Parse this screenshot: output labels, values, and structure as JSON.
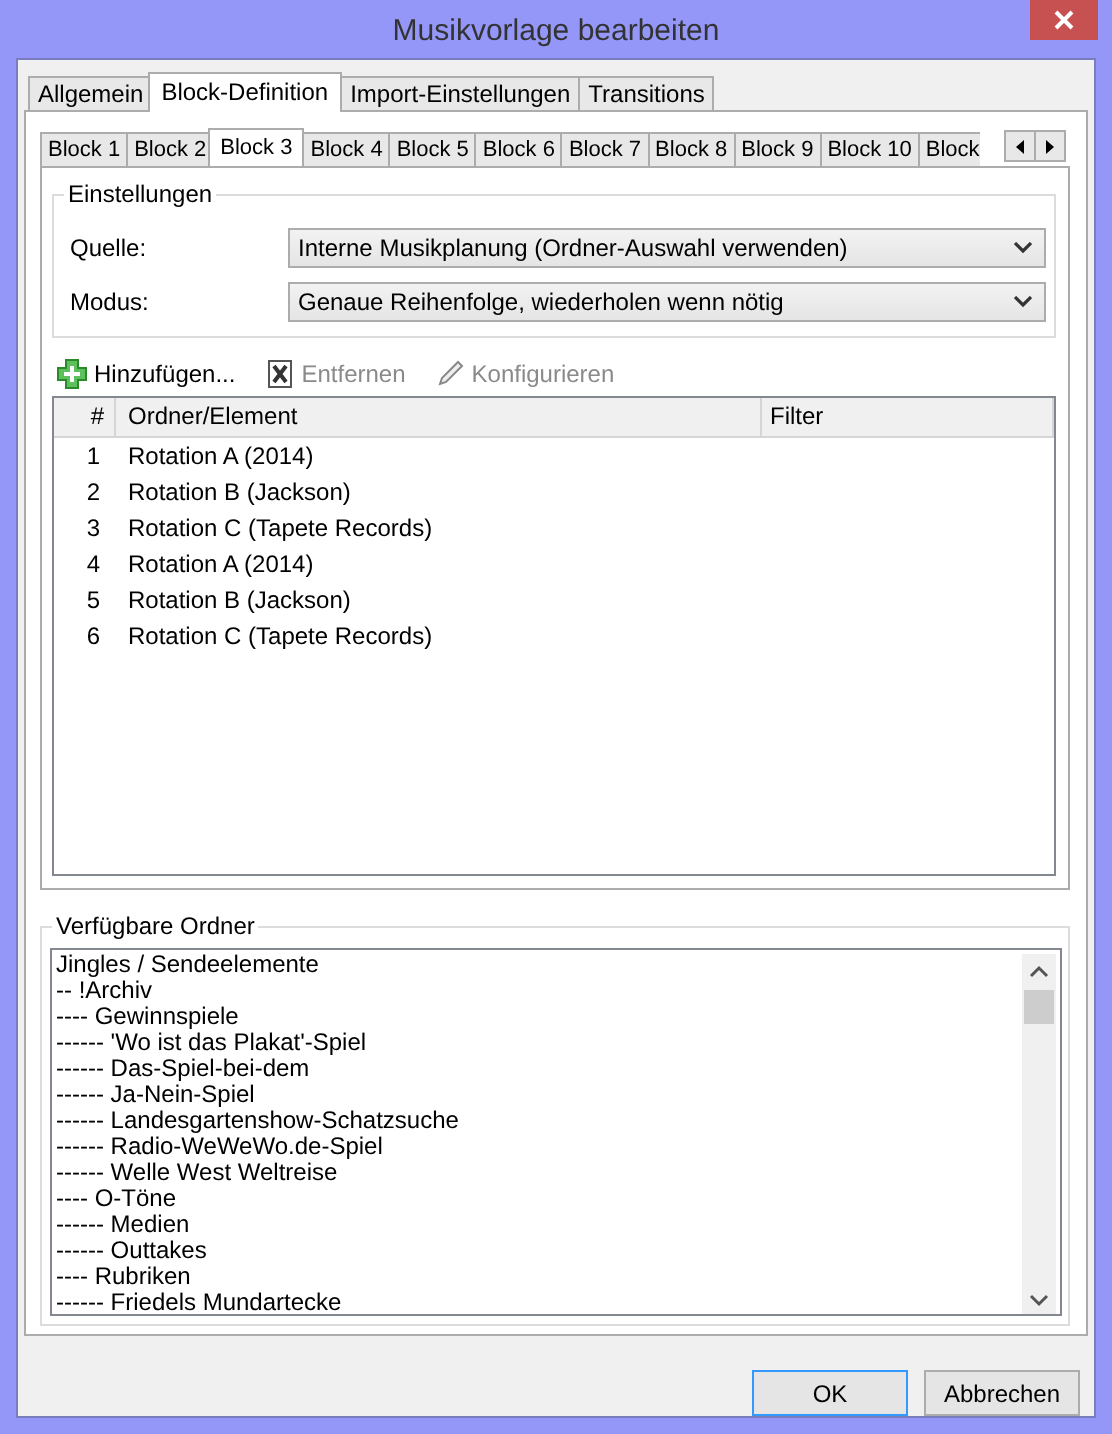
{
  "window": {
    "title": "Musikvorlage bearbeiten"
  },
  "tabs": [
    {
      "label": "Allgemein",
      "selected": false
    },
    {
      "label": "Block-Definition",
      "selected": true
    },
    {
      "label": "Import-Einstellungen",
      "selected": false
    },
    {
      "label": "Transitions",
      "selected": false
    }
  ],
  "block_tabs": [
    {
      "label": "Block 1",
      "selected": false
    },
    {
      "label": "Block 2",
      "selected": false
    },
    {
      "label": "Block 3",
      "selected": true
    },
    {
      "label": "Block 4",
      "selected": false
    },
    {
      "label": "Block 5",
      "selected": false
    },
    {
      "label": "Block 6",
      "selected": false
    },
    {
      "label": "Block 7",
      "selected": false
    },
    {
      "label": "Block 8",
      "selected": false
    },
    {
      "label": "Block 9",
      "selected": false
    },
    {
      "label": "Block 10",
      "selected": false
    },
    {
      "label": "Block",
      "selected": false
    }
  ],
  "settings": {
    "title": "Einstellungen",
    "fields": [
      {
        "label": "Quelle:",
        "value": "Interne Musikplanung (Ordner-Auswahl verwenden)"
      },
      {
        "label": "Modus:",
        "value": "Genaue Reihenfolge, wiederholen wenn nötig"
      }
    ]
  },
  "toolbar": [
    {
      "kind": "add",
      "label": "Hinzufügen...",
      "disabled": false
    },
    {
      "kind": "remove",
      "label": "Entfernen",
      "disabled": true
    },
    {
      "kind": "edit",
      "label": "Konfigurieren",
      "disabled": true
    }
  ],
  "table": {
    "columns": [
      "#",
      "Ordner/Element",
      "Filter"
    ],
    "rows": [
      [
        "1",
        "Rotation A (2014)",
        ""
      ],
      [
        "2",
        "Rotation B (Jackson)",
        ""
      ],
      [
        "3",
        "Rotation C (Tapete Records)",
        ""
      ],
      [
        "4",
        "Rotation A (2014)",
        ""
      ],
      [
        "5",
        "Rotation B (Jackson)",
        ""
      ],
      [
        "6",
        "Rotation C (Tapete Records)",
        ""
      ]
    ]
  },
  "folders": {
    "title": "Verfügbare Ordner",
    "items": [
      "Jingles / Sendeelemente",
      "-- !Archiv",
      "---- Gewinnspiele",
      "------ 'Wo ist das Plakat'-Spiel",
      "------ Das-Spiel-bei-dem",
      "------ Ja-Nein-Spiel",
      "------ Landesgartenshow-Schatzsuche",
      "------ Radio-WeWeWo.de-Spiel",
      "------ Welle West Weltreise",
      "---- O-Töne",
      "------ Medien",
      "------ Outtakes",
      "---- Rubriken",
      "------ Friedels Mundartecke"
    ]
  },
  "buttons": [
    {
      "label": "OK",
      "kind": "default"
    },
    {
      "label": "Abbrechen",
      "kind": "normal"
    }
  ]
}
